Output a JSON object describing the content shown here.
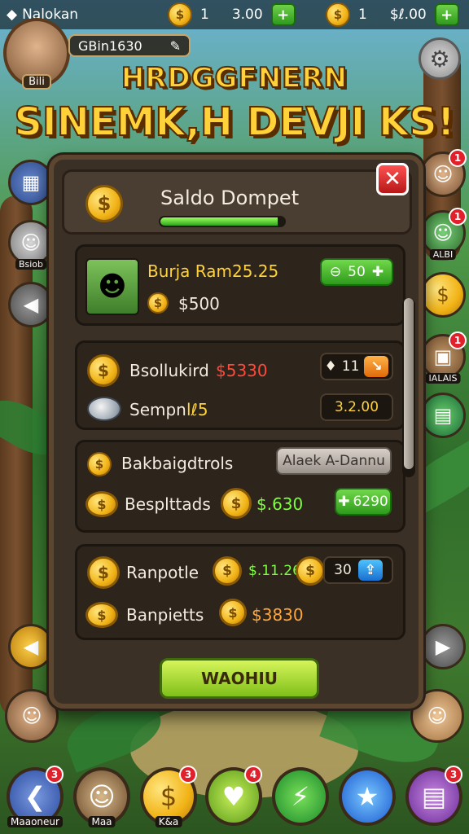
{
  "status_bar": {
    "app_name": "Nalokan",
    "resource1": {
      "count": "1",
      "value": "3.00"
    },
    "resource2": {
      "count": "1",
      "value": "$ℓ.00"
    }
  },
  "header": {
    "player_label": "Bili",
    "player_id": "GBin1630",
    "title_line1": "HRDGGFNERN",
    "title_line2": "SINEMK,H DEVJI KS!"
  },
  "modal": {
    "title": "Saldo Dompet",
    "progress": 0.95,
    "item": {
      "name": "Burja Ram25.25",
      "price": "$500",
      "pill": "50"
    },
    "rows": [
      {
        "label": "Bsollukird",
        "value": "$5330",
        "pill": "11"
      },
      {
        "label": "Sempn",
        "value": "lℓ5",
        "pill": "3.2.00"
      },
      {
        "label": "Bakbaigdtrols",
        "value": "",
        "pill": "Alaek A-Dannu"
      },
      {
        "label": "Besplttads",
        "value": "$.630",
        "pill": "6290"
      },
      {
        "label": "Ranpotle",
        "value": "$.11.26",
        "pill": "30"
      },
      {
        "label": "Banpietts",
        "value": "$3830",
        "pill": ""
      }
    ],
    "action_label": "WAOHIU"
  },
  "side_left": [
    {
      "label": "",
      "icon": "map-icon"
    },
    {
      "label": "Bsiob",
      "icon": "avatar-icon"
    },
    {
      "label": "",
      "icon": "arrow-left-icon"
    },
    {
      "label": "",
      "icon": "arrow-left-icon"
    }
  ],
  "side_right": [
    {
      "label": "",
      "icon": "avatar-icon",
      "badge": "1"
    },
    {
      "label": "ALBI",
      "icon": "avatar-icon",
      "badge": "1"
    },
    {
      "label": "",
      "icon": "coin-icon"
    },
    {
      "label": "IALAIS",
      "icon": "chest-icon",
      "badge": "1"
    },
    {
      "label": "",
      "icon": "box-icon"
    },
    {
      "label": "",
      "icon": "arrow-right-icon"
    }
  ],
  "bottom_nav": [
    {
      "label": "Maaoneur",
      "icon": "back-icon",
      "badge": "3"
    },
    {
      "label": "Maa",
      "icon": "hero-icon",
      "badge": ""
    },
    {
      "label": "K&a",
      "icon": "coin-icon",
      "badge": "3"
    },
    {
      "label": "",
      "icon": "heart-icon",
      "badge": "4"
    },
    {
      "label": "",
      "icon": "lightning-icon",
      "badge": ""
    },
    {
      "label": "",
      "icon": "star-icon",
      "badge": ""
    },
    {
      "label": "",
      "icon": "cards-icon",
      "badge": "3"
    }
  ]
}
